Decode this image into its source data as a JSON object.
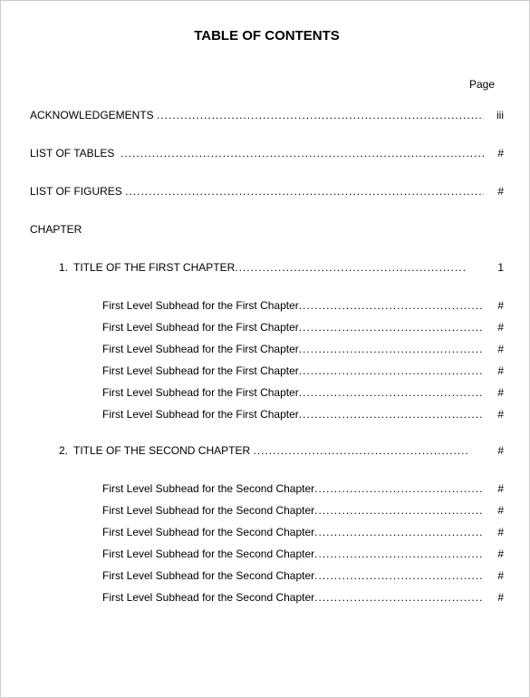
{
  "title": "TABLE OF CONTENTS",
  "pageLabel": "Page",
  "front": [
    {
      "label": "ACKNOWLEDGEMENTS ",
      "page": "iii"
    },
    {
      "label": "LIST OF TABLES  ",
      "page": "#"
    },
    {
      "label": "LIST OF FIGURES ",
      "page": "#"
    }
  ],
  "chapterHeading": "CHAPTER",
  "chapters": [
    {
      "num": "1.",
      "title": "TITLE OF THE FIRST CHAPTER",
      "page": "1",
      "subs": [
        {
          "label": "First Level Subhead for the First Chapter",
          "page": "#"
        },
        {
          "label": "First Level Subhead for the First Chapter",
          "page": "#"
        },
        {
          "label": "First Level Subhead for the First Chapter",
          "page": "#"
        },
        {
          "label": "First Level Subhead for the First Chapter",
          "page": "#"
        },
        {
          "label": "First Level Subhead for the First Chapter",
          "page": "#"
        },
        {
          "label": "First Level Subhead for the First Chapter",
          "page": "#"
        }
      ]
    },
    {
      "num": "2.",
      "title": "TITLE OF THE SECOND CHAPTER ",
      "page": "#",
      "subs": [
        {
          "label": "First Level Subhead for the Second Chapter",
          "page": "#"
        },
        {
          "label": "First Level Subhead for the Second Chapter",
          "page": "#"
        },
        {
          "label": "First Level Subhead for the Second Chapter",
          "page": "#"
        },
        {
          "label": "First Level Subhead for the Second Chapter",
          "page": "#"
        },
        {
          "label": "First Level Subhead for the Second Chapter",
          "page": "#"
        },
        {
          "label": "First Level Subhead for the Second Chapter",
          "page": "#"
        }
      ]
    }
  ]
}
